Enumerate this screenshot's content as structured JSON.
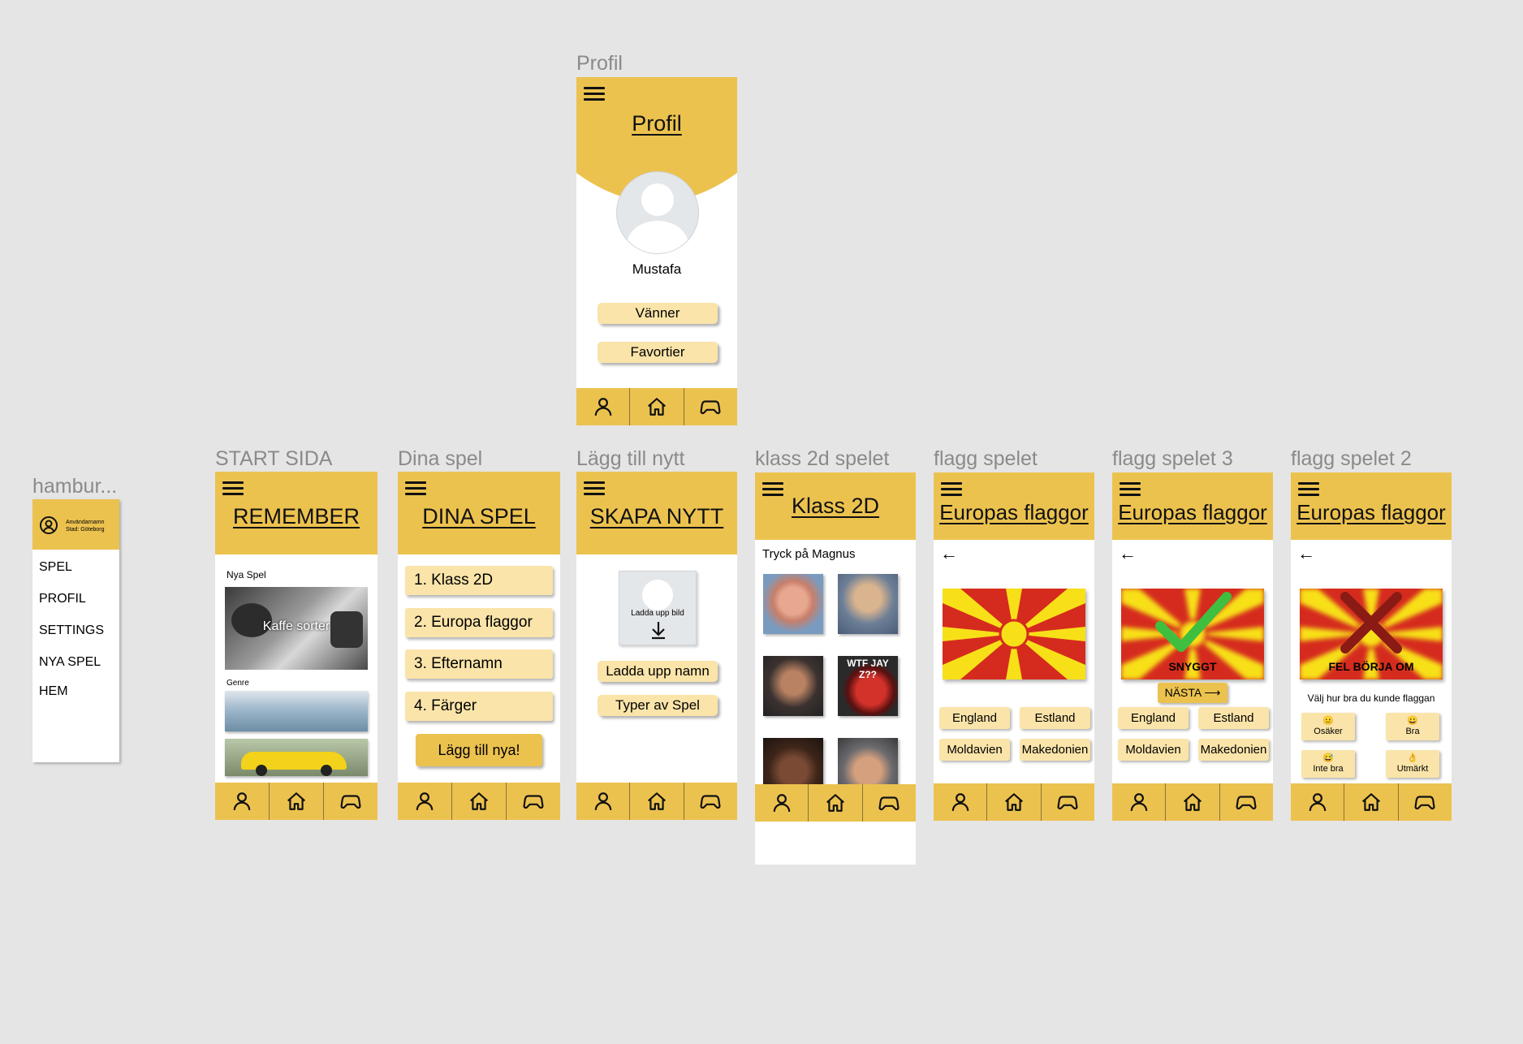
{
  "frames": {
    "hamburger": {
      "label": "hambur...",
      "user_name": "Användarnamn",
      "user_city": "Stad: Göteborg",
      "items": [
        "SPEL",
        "PROFIL",
        "SETTINGS",
        "NYA SPEL",
        "HEM"
      ]
    },
    "start": {
      "label": "START SIDA",
      "title": "REMEMBER",
      "new_games": "Nya Spel",
      "card_text": "Kaffe sorter",
      "genre": "Genre"
    },
    "dina_spel": {
      "label": "Dina spel",
      "title": "DINA SPEL",
      "items": [
        "1. Klass 2D",
        "2. Europa flaggor",
        "3. Efternamn",
        "4. Färger"
      ],
      "add_button": "Lägg till nya!"
    },
    "profil": {
      "label": "Profil",
      "title": "Profil",
      "name": "Mustafa",
      "buttons": [
        "Vänner",
        "Favortier"
      ]
    },
    "lagg_till": {
      "label": "Lägg till nytt",
      "title": "SKAPA NYTT",
      "upload_image": "Ladda upp bild",
      "upload_name": "Ladda upp namn",
      "game_types": "Typer av Spel"
    },
    "klass2d": {
      "label": "klass 2d spelet",
      "title": "Klass 2D",
      "instruction": "Tryck på Magnus",
      "meme_text": "WTF JAY Z??"
    },
    "flagg": {
      "label": "flagg spelet",
      "title": "Europas flaggor",
      "back": "←",
      "answers": [
        "England",
        "Estland",
        "Moldavien",
        "Makedonien"
      ]
    },
    "flagg3": {
      "label": "flagg spelet 3",
      "title": "Europas flaggor",
      "back": "←",
      "result": "SNYGGT",
      "next": "NÄSTA",
      "answers": [
        "England",
        "Estland",
        "Moldavien",
        "Makedonien"
      ]
    },
    "flagg2": {
      "label": "flagg spelet 2",
      "title": "Europas flaggor",
      "back": "←",
      "result": "FEL BÖRJA OM",
      "question": "Välj hur bra du kunde flaggan",
      "ratings": [
        {
          "emoji": "😐",
          "label": "Osäker"
        },
        {
          "emoji": "😀",
          "label": "Bra"
        },
        {
          "emoji": "😅",
          "label": "Inte bra"
        },
        {
          "emoji": "👌",
          "label": "Utmärkt"
        }
      ]
    }
  },
  "icons": {
    "nav": [
      "person-icon",
      "home-icon",
      "gamepad-icon"
    ]
  },
  "colors": {
    "accent": "#ecc24f",
    "button": "#fae4a9",
    "flag_red": "#d52b1e",
    "flag_yellow": "#f7e018"
  }
}
